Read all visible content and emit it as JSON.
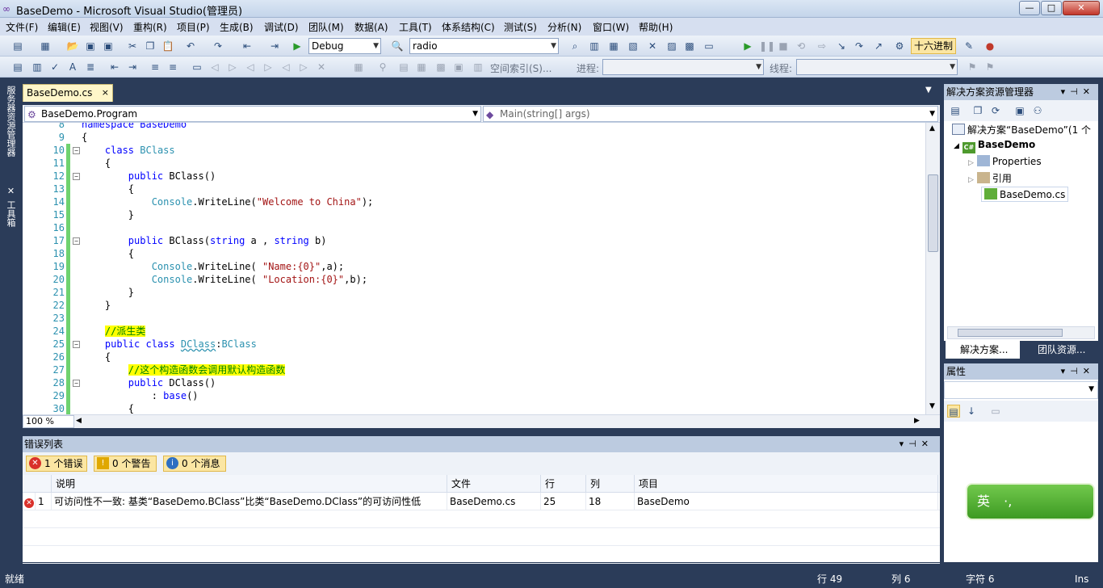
{
  "window": {
    "title": "BaseDemo - Microsoft Visual Studio(管理员)",
    "min_symbol": "—",
    "max_symbol": "□",
    "close_symbol": "✕"
  },
  "menu": [
    "文件(F)",
    "编辑(E)",
    "视图(V)",
    "重构(R)",
    "项目(P)",
    "生成(B)",
    "调试(D)",
    "团队(M)",
    "数据(A)",
    "工具(T)",
    "体系结构(C)",
    "测试(S)",
    "分析(N)",
    "窗口(W)",
    "帮助(H)"
  ],
  "toolbar": {
    "config": "Debug",
    "find": "radio",
    "hex_label": "十六进制",
    "index_label": "空间索引(S)...",
    "process_label": "进程:",
    "thread_label": "线程:"
  },
  "left_strip": {
    "server_explorer": "服务器资源管理器",
    "toolbox": "工具箱"
  },
  "editor": {
    "tab_label": "BaseDemo.cs",
    "tab_close": "×",
    "nav_left": "BaseDemo.Program",
    "nav_right": "Main(string[] args)",
    "zoom": "100 %",
    "lines": [
      {
        "n": "8",
        "fold": "",
        "bar": false,
        "tokens": [
          {
            "t": "namespace BaseDemo",
            "c": "kw"
          }
        ]
      },
      {
        "n": "9",
        "fold": "",
        "bar": false,
        "tokens": [
          {
            "t": "{",
            "c": ""
          }
        ]
      },
      {
        "n": "10",
        "fold": "−",
        "bar": true,
        "tokens": [
          {
            "t": "    ",
            "c": ""
          },
          {
            "t": "class",
            "c": "kw"
          },
          {
            "t": " ",
            "c": ""
          },
          {
            "t": "BClass",
            "c": "ty"
          }
        ]
      },
      {
        "n": "11",
        "fold": "",
        "bar": true,
        "tokens": [
          {
            "t": "    {",
            "c": ""
          }
        ]
      },
      {
        "n": "12",
        "fold": "−",
        "bar": true,
        "tokens": [
          {
            "t": "        ",
            "c": ""
          },
          {
            "t": "public",
            "c": "kw"
          },
          {
            "t": " BClass()",
            "c": ""
          }
        ]
      },
      {
        "n": "13",
        "fold": "",
        "bar": true,
        "tokens": [
          {
            "t": "        {",
            "c": ""
          }
        ]
      },
      {
        "n": "14",
        "fold": "",
        "bar": true,
        "tokens": [
          {
            "t": "            ",
            "c": ""
          },
          {
            "t": "Console",
            "c": "ty"
          },
          {
            "t": ".WriteLine(",
            "c": ""
          },
          {
            "t": "\"Welcome to China\"",
            "c": "str"
          },
          {
            "t": ");",
            "c": ""
          }
        ]
      },
      {
        "n": "15",
        "fold": "",
        "bar": true,
        "tokens": [
          {
            "t": "        }",
            "c": ""
          }
        ]
      },
      {
        "n": "16",
        "fold": "",
        "bar": true,
        "tokens": [
          {
            "t": "",
            "c": ""
          }
        ]
      },
      {
        "n": "17",
        "fold": "−",
        "bar": true,
        "tokens": [
          {
            "t": "        ",
            "c": ""
          },
          {
            "t": "public",
            "c": "kw"
          },
          {
            "t": " BClass(",
            "c": ""
          },
          {
            "t": "string",
            "c": "kw"
          },
          {
            "t": " a , ",
            "c": ""
          },
          {
            "t": "string",
            "c": "kw"
          },
          {
            "t": " b)",
            "c": ""
          }
        ]
      },
      {
        "n": "18",
        "fold": "",
        "bar": true,
        "tokens": [
          {
            "t": "        {",
            "c": ""
          }
        ]
      },
      {
        "n": "19",
        "fold": "",
        "bar": true,
        "tokens": [
          {
            "t": "            ",
            "c": ""
          },
          {
            "t": "Console",
            "c": "ty"
          },
          {
            "t": ".WriteLine( ",
            "c": ""
          },
          {
            "t": "\"Name:{0}\"",
            "c": "str"
          },
          {
            "t": ",a);",
            "c": ""
          }
        ]
      },
      {
        "n": "20",
        "fold": "",
        "bar": true,
        "tokens": [
          {
            "t": "            ",
            "c": ""
          },
          {
            "t": "Console",
            "c": "ty"
          },
          {
            "t": ".WriteLine( ",
            "c": ""
          },
          {
            "t": "\"Location:{0}\"",
            "c": "str"
          },
          {
            "t": ",b);",
            "c": ""
          }
        ]
      },
      {
        "n": "21",
        "fold": "",
        "bar": true,
        "tokens": [
          {
            "t": "        }",
            "c": ""
          }
        ]
      },
      {
        "n": "22",
        "fold": "",
        "bar": true,
        "tokens": [
          {
            "t": "    }",
            "c": ""
          }
        ]
      },
      {
        "n": "23",
        "fold": "",
        "bar": true,
        "tokens": [
          {
            "t": "",
            "c": ""
          }
        ]
      },
      {
        "n": "24",
        "fold": "",
        "bar": true,
        "tokens": [
          {
            "t": "    ",
            "c": ""
          },
          {
            "t": "//派生类",
            "c": "cm"
          }
        ]
      },
      {
        "n": "25",
        "fold": "−",
        "bar": true,
        "tokens": [
          {
            "t": "    ",
            "c": ""
          },
          {
            "t": "public",
            "c": "kw"
          },
          {
            "t": " ",
            "c": ""
          },
          {
            "t": "class",
            "c": "kw"
          },
          {
            "t": " ",
            "c": ""
          },
          {
            "t": "DClass",
            "c": "ty sq"
          },
          {
            "t": ":",
            "c": ""
          },
          {
            "t": "BClass",
            "c": "ty"
          }
        ]
      },
      {
        "n": "26",
        "fold": "",
        "bar": true,
        "tokens": [
          {
            "t": "    {",
            "c": ""
          }
        ]
      },
      {
        "n": "27",
        "fold": "",
        "bar": true,
        "tokens": [
          {
            "t": "        ",
            "c": ""
          },
          {
            "t": "//这个构造函数会调用默认构造函数",
            "c": "cm"
          }
        ]
      },
      {
        "n": "28",
        "fold": "−",
        "bar": true,
        "tokens": [
          {
            "t": "        ",
            "c": ""
          },
          {
            "t": "public",
            "c": "kw"
          },
          {
            "t": " DClass()",
            "c": ""
          }
        ]
      },
      {
        "n": "29",
        "fold": "",
        "bar": true,
        "tokens": [
          {
            "t": "            : ",
            "c": ""
          },
          {
            "t": "base",
            "c": "kw"
          },
          {
            "t": "()",
            "c": ""
          }
        ]
      },
      {
        "n": "30",
        "fold": "",
        "bar": true,
        "tokens": [
          {
            "t": "        {",
            "c": ""
          }
        ]
      }
    ]
  },
  "error_list": {
    "title": "错误列表",
    "filters": [
      {
        "label": "1 个错误",
        "icon": "✕",
        "color": "#d9302a"
      },
      {
        "label": "0 个警告",
        "icon": "!",
        "color": "#e0a800"
      },
      {
        "label": "0 个消息",
        "icon": "i",
        "color": "#2f6fc1"
      }
    ],
    "columns": [
      "说明",
      "文件",
      "行",
      "列",
      "项目"
    ],
    "rows": [
      {
        "num": "1",
        "desc": "可访问性不一致: 基类“BaseDemo.BClass”比类“BaseDemo.DClass”的可访问性低",
        "file": "BaseDemo.cs",
        "line": "25",
        "col": "18",
        "project": "BaseDemo"
      }
    ]
  },
  "solution_explorer": {
    "title": "解决方案资源管理器",
    "solution": "解决方案“BaseDemo”(1 个",
    "project": "BaseDemo",
    "items": [
      "Properties",
      "引用",
      "BaseDemo.cs"
    ],
    "tabs": [
      "解决方案...",
      "团队资源..."
    ]
  },
  "properties": {
    "title": "属性"
  },
  "ime": {
    "label": "英",
    "punct": "·,"
  },
  "status": {
    "ready": "就绪",
    "line": "行 49",
    "col": "列 6",
    "char": "字符 6",
    "mode": "Ins"
  }
}
